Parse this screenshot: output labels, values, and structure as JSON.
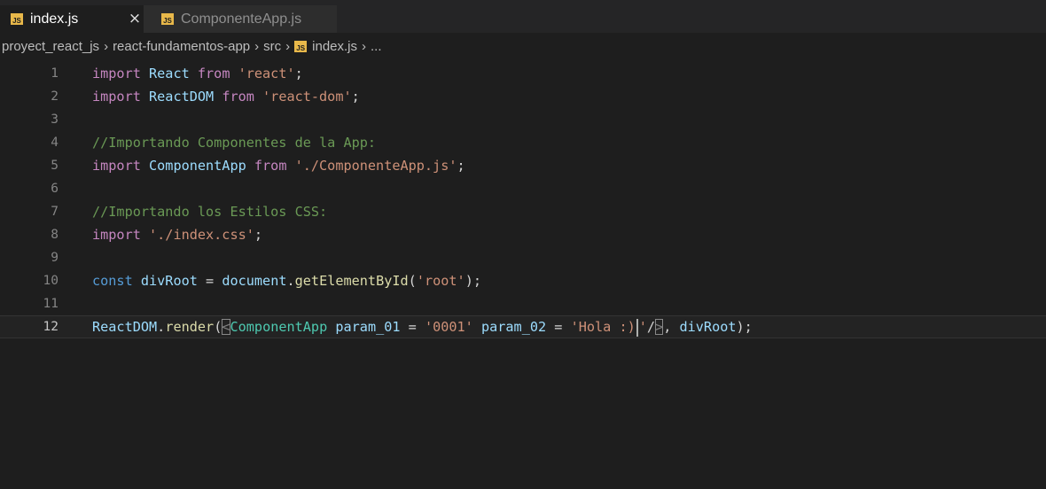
{
  "tabs": [
    {
      "label": "index.js",
      "icon": "JS",
      "active": true,
      "close": "×"
    },
    {
      "label": "ComponenteApp.js",
      "icon": "JS",
      "active": false
    }
  ],
  "breadcrumb": {
    "items": [
      "proyect_react_js",
      "react-fundamentos-app",
      "src",
      "index.js",
      "..."
    ],
    "separator": "›",
    "file_icon": "JS"
  },
  "editor": {
    "current_line": 12,
    "lines": [
      {
        "number": "1",
        "tokens": [
          [
            "kw",
            "import "
          ],
          [
            "var",
            "React "
          ],
          [
            "kw",
            "from "
          ],
          [
            "str",
            "'react'"
          ],
          [
            "pun",
            ";"
          ]
        ]
      },
      {
        "number": "2",
        "tokens": [
          [
            "kw",
            "import "
          ],
          [
            "var",
            "ReactDOM "
          ],
          [
            "kw",
            "from "
          ],
          [
            "str",
            "'react-dom'"
          ],
          [
            "pun",
            ";"
          ]
        ]
      },
      {
        "number": "3",
        "tokens": []
      },
      {
        "number": "4",
        "tokens": [
          [
            "com",
            "//Importando Componentes de la App:"
          ]
        ]
      },
      {
        "number": "5",
        "tokens": [
          [
            "kw",
            "import "
          ],
          [
            "var",
            "ComponentApp "
          ],
          [
            "kw",
            "from "
          ],
          [
            "str",
            "'./ComponenteApp.js'"
          ],
          [
            "pun",
            ";"
          ]
        ]
      },
      {
        "number": "6",
        "tokens": []
      },
      {
        "number": "7",
        "tokens": [
          [
            "com",
            "//Importando los Estilos CSS:"
          ]
        ]
      },
      {
        "number": "8",
        "tokens": [
          [
            "kw",
            "import "
          ],
          [
            "str",
            "'./index.css'"
          ],
          [
            "pun",
            ";"
          ]
        ]
      },
      {
        "number": "9",
        "tokens": []
      },
      {
        "number": "10",
        "tokens": [
          [
            "kw2",
            "const "
          ],
          [
            "var",
            "divRoot "
          ],
          [
            "pun",
            "= "
          ],
          [
            "var",
            "document"
          ],
          [
            "pun",
            "."
          ],
          [
            "fn",
            "getElementById"
          ],
          [
            "pun",
            "("
          ],
          [
            "str",
            "'root'"
          ],
          [
            "pun",
            ");"
          ]
        ]
      },
      {
        "number": "11",
        "tokens": []
      },
      {
        "number": "12",
        "tokens": [
          [
            "var",
            "ReactDOM"
          ],
          [
            "pun",
            "."
          ],
          [
            "fn",
            "render"
          ],
          [
            "pun",
            "("
          ],
          [
            "match",
            "<"
          ],
          [
            "tag",
            "ComponentApp "
          ],
          [
            "var",
            "param_01 "
          ],
          [
            "pun",
            "= "
          ],
          [
            "str",
            "'0001' "
          ],
          [
            "var",
            "param_02 "
          ],
          [
            "pun",
            "= "
          ],
          [
            "str",
            "'Hola :)"
          ],
          [
            "cursor",
            ""
          ],
          [
            "str",
            "'"
          ],
          [
            "pun",
            "/"
          ],
          [
            "match",
            ">"
          ],
          [
            "pun",
            ", "
          ],
          [
            "var",
            "divRoot"
          ],
          [
            "pun",
            ");"
          ]
        ]
      }
    ]
  },
  "colors": {
    "background": "#1e1e1e",
    "tab_bar": "#252526",
    "keyword": "#c586c0",
    "string": "#ce9178",
    "comment": "#6a9955",
    "variable": "#9cdcfe",
    "function": "#dcdcaa",
    "js_icon": "#e8b84a"
  }
}
